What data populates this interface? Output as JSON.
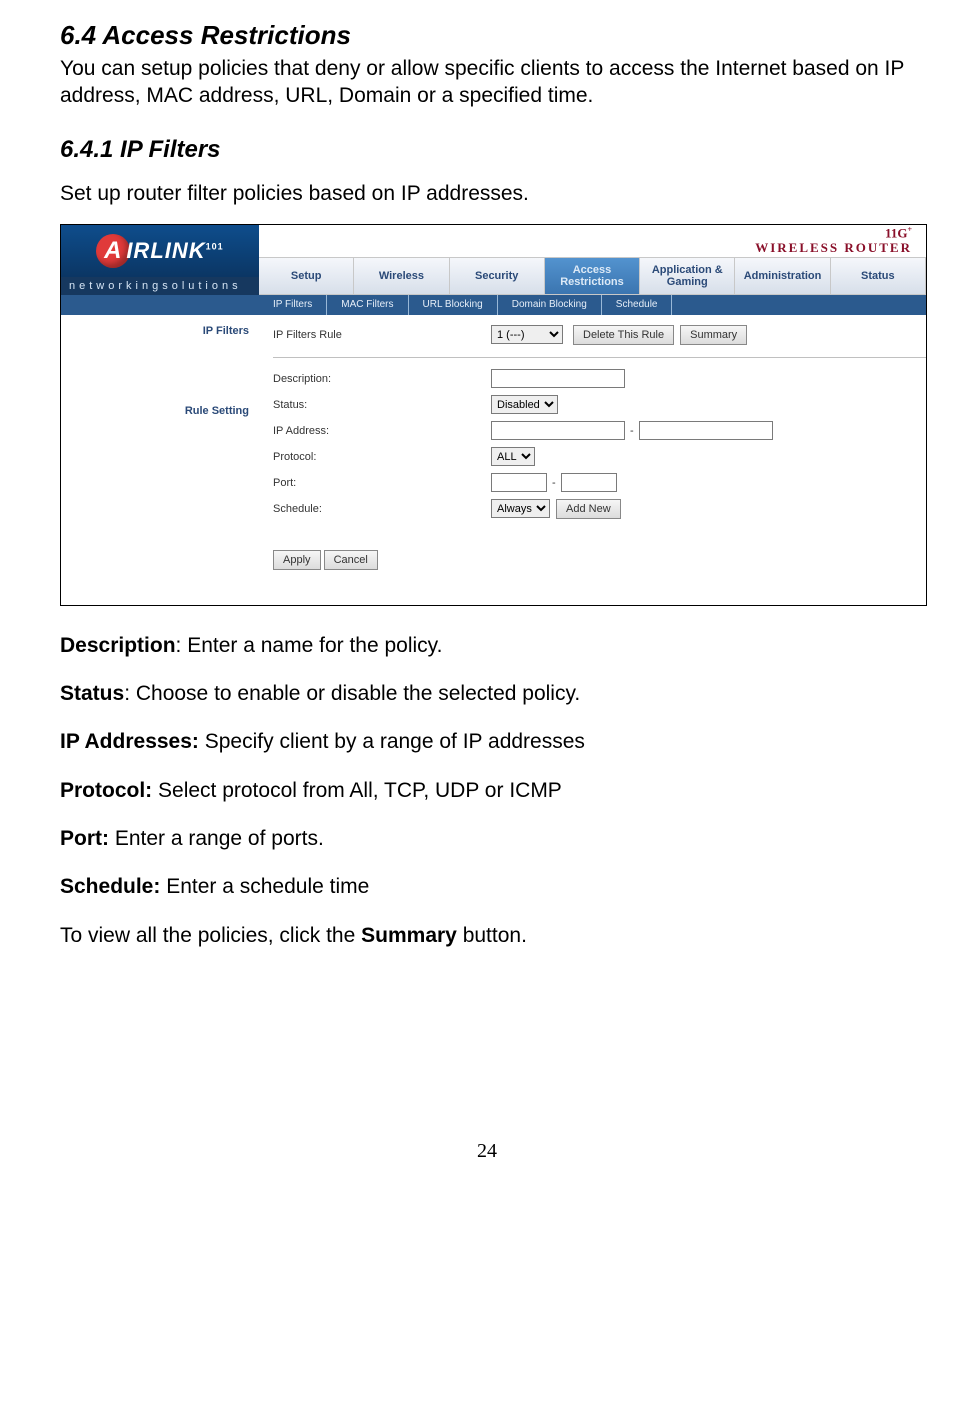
{
  "doc": {
    "h64": "6.4 Access Restrictions",
    "h64_para": "You can setup policies that deny or allow specific clients to access the Internet based on IP address, MAC address, URL, Domain or a specified time.",
    "h641": "6.4.1 IP Filters",
    "h641_intro": "Set up router filter policies based on IP addresses.",
    "page_number": "24"
  },
  "screenshot": {
    "logo": {
      "a": "A",
      "rest": "IRLINK",
      "sup": "101",
      "sub": "networkingsolutions"
    },
    "brand": {
      "line1_a": "11G",
      "line1_sup": "+",
      "line2": "WIRELESS ROUTER"
    },
    "main_tabs": [
      "Setup",
      "Wireless",
      "Security",
      "Access Restrictions",
      "Application & Gaming",
      "Administration",
      "Status"
    ],
    "main_active_index": 3,
    "sub_tabs": [
      "IP Filters",
      "MAC Filters",
      "URL Blocking",
      "Domain Blocking",
      "Schedule"
    ],
    "sub_active_index": 0,
    "side": {
      "ip_filters": "IP Filters",
      "rule_setting": "Rule Setting"
    },
    "form": {
      "rule_label": "IP Filters Rule",
      "rule_select": "1 (---)",
      "delete_btn": "Delete This Rule",
      "summary_btn": "Summary",
      "description_label": "Description:",
      "description_value": "",
      "status_label": "Status:",
      "status_value": "Disabled",
      "ip_label": "IP Address:",
      "ip_from": "",
      "ip_to": "",
      "protocol_label": "Protocol:",
      "protocol_value": "ALL",
      "port_label": "Port:",
      "port_from": "",
      "port_to": "",
      "schedule_label": "Schedule:",
      "schedule_value": "Always",
      "addnew_btn": "Add New",
      "apply_btn": "Apply",
      "cancel_btn": "Cancel"
    }
  },
  "definitions": {
    "description": {
      "term": "Description",
      "text": ": Enter a name for the policy."
    },
    "status": {
      "term": "Status",
      "text": ": Choose to enable or disable the selected policy."
    },
    "ip": {
      "term": "IP Addresses:",
      "text": " Specify client by a range of IP addresses"
    },
    "protocol": {
      "term": "Protocol:",
      "text": " Select protocol from All, TCP, UDP or ICMP"
    },
    "port": {
      "term": "Port:",
      "text": " Enter a range of ports."
    },
    "schedule": {
      "term": "Schedule:",
      "text": " Enter a schedule time"
    },
    "summary": {
      "pre": "To view all the policies, click the ",
      "bold": "Summary",
      "post": " button."
    }
  }
}
